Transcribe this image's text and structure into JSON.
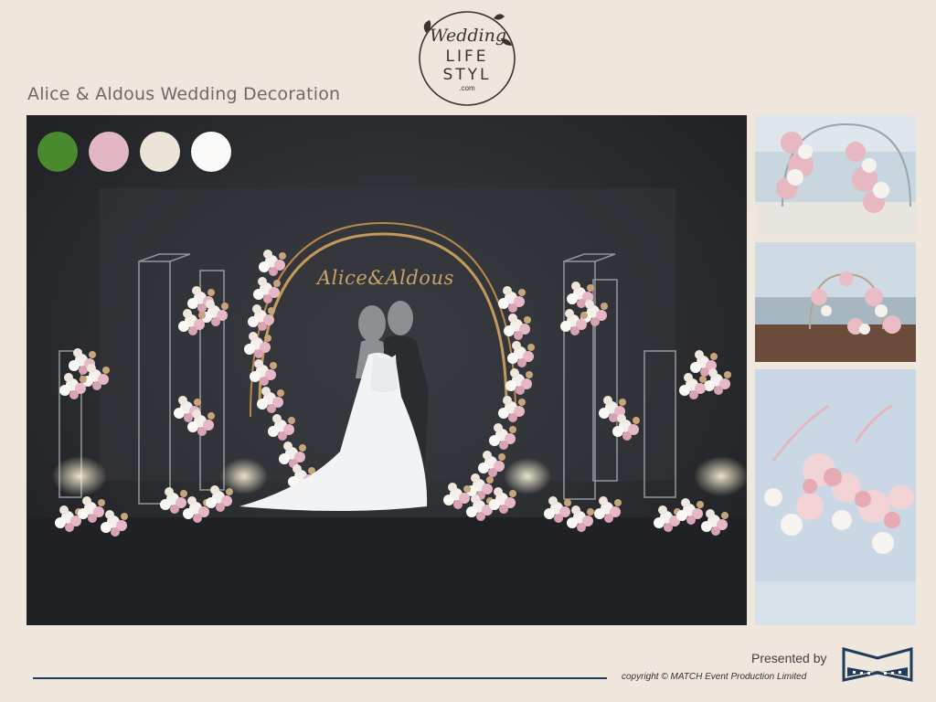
{
  "slide": {
    "title": "Alice & Aldous Wedding Decoration"
  },
  "logo": {
    "script_text": "Wedding",
    "line1": "LIFE",
    "line2": "STYL",
    "domain": ".com"
  },
  "main_render": {
    "couple_names": "Alice&Aldous",
    "palette": [
      {
        "name": "green",
        "color": "#4a8a2e"
      },
      {
        "name": "pink",
        "color": "#e2b6c3"
      },
      {
        "name": "ivory",
        "color": "#ece4d6"
      },
      {
        "name": "white",
        "color": "#fbfaf8"
      }
    ]
  },
  "footer": {
    "presented_by": "Presented by",
    "copyright": "copyright © MATCH Event Production Limited",
    "line_color": "#1e3a5c"
  }
}
